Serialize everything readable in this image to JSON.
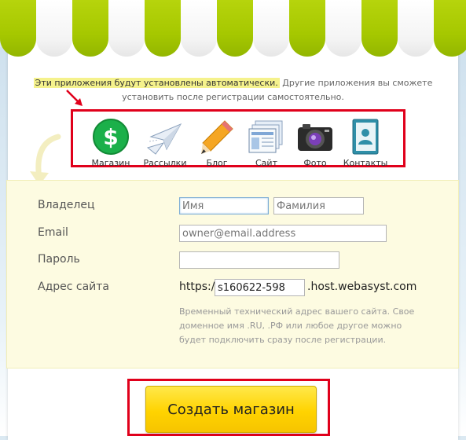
{
  "intro": {
    "highlight": "Эти приложения будут установлены автоматически.",
    "rest": "Другие приложения вы сможете установить после регистрации самостоятельно."
  },
  "apps": [
    {
      "label": "Магазин",
      "icon": "dollar-icon"
    },
    {
      "label": "Рассылки",
      "icon": "paper-planes-icon"
    },
    {
      "label": "Блог",
      "icon": "pencil-icon"
    },
    {
      "label": "Сайт",
      "icon": "website-icon"
    },
    {
      "label": "Фото",
      "icon": "camera-icon"
    },
    {
      "label": "Контакты",
      "icon": "contacts-book-icon"
    }
  ],
  "form": {
    "owner_label": "Владелец",
    "first_name_placeholder": "Имя",
    "last_name_placeholder": "Фамилия",
    "email_label": "Email",
    "email_placeholder": "owner@email.address",
    "password_label": "Пароль",
    "site_label": "Адрес сайта",
    "url_prefix": "https://",
    "subdomain_value": "s160622-598",
    "url_suffix": ".host.webasyst.com",
    "hint": "Временный технический адрес вашего сайта. Свое доменное имя .RU, .РФ или любое другое можно будет подключить сразу после регистрации."
  },
  "submit_label": "Создать магазин",
  "colors": {
    "awning_green": "#a6c800",
    "highlight": "#f5f28c",
    "annotation_red": "#e0001b",
    "button_yellow": "#ffd300",
    "panel_bg": "#fdfbe1"
  }
}
